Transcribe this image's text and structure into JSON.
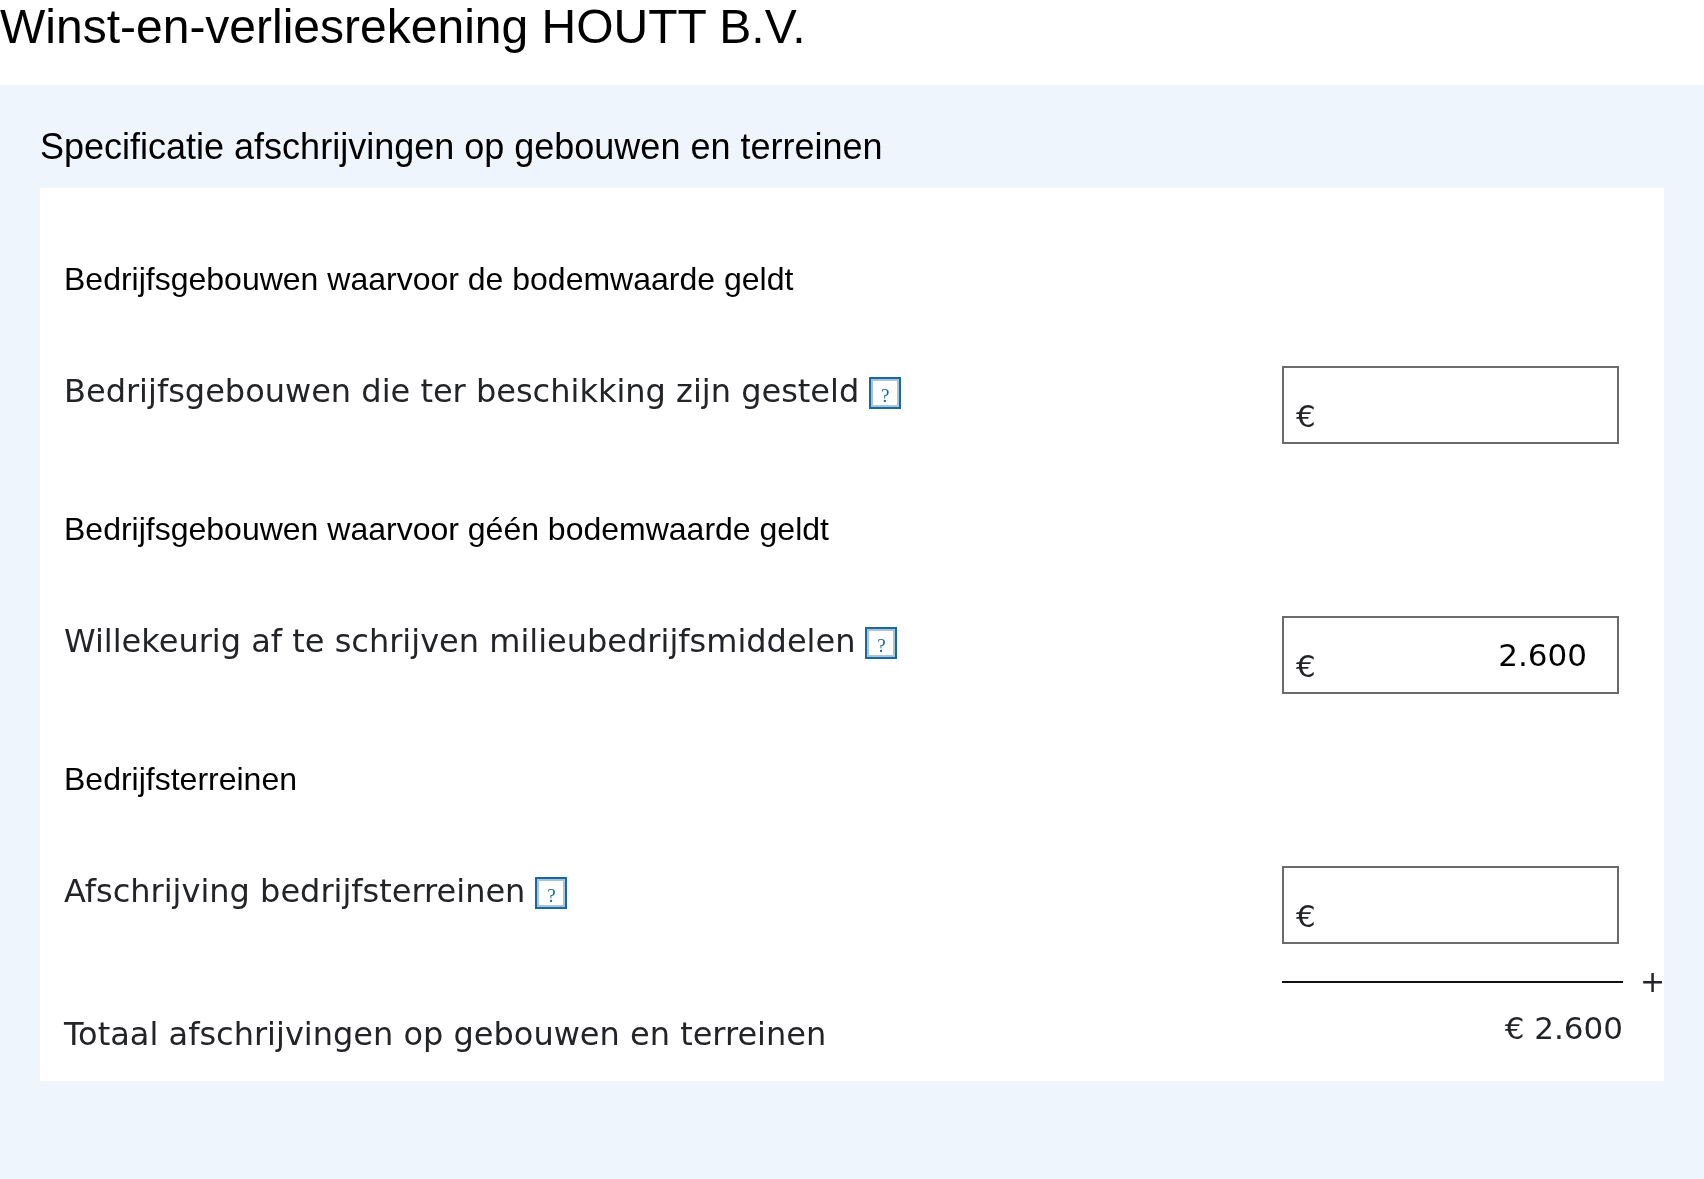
{
  "title": "Winst-en-verliesrekening HOUTT B.V.",
  "section": {
    "title": "Specificatie afschrijvingen op gebouwen en terreinen",
    "groups": [
      {
        "heading": "Bedrijfsgebouwen waarvoor de bodemwaarde geldt",
        "fields": [
          {
            "label": "Bedrijfsgebouwen die ter beschikking zijn gesteld",
            "help": "?",
            "currency": "€"
          }
        ]
      },
      {
        "heading": "Bedrijfsgebouwen waarvoor géén bodemwaarde geldt",
        "fields": [
          {
            "label": "Willekeurig af te schrijven milieubedrijfsmiddelen",
            "help": "?",
            "currency": "€",
            "value": "2.600"
          }
        ]
      },
      {
        "heading": "Bedrijfsterreinen",
        "fields": [
          {
            "label": "Afschrijving bedrijfsterreinen",
            "help": "?",
            "currency": "€"
          }
        ]
      }
    ],
    "sum_operator": "+",
    "total": {
      "label": "Totaal afschrijvingen op gebouwen en terreinen",
      "value": "€ 2.600"
    }
  }
}
